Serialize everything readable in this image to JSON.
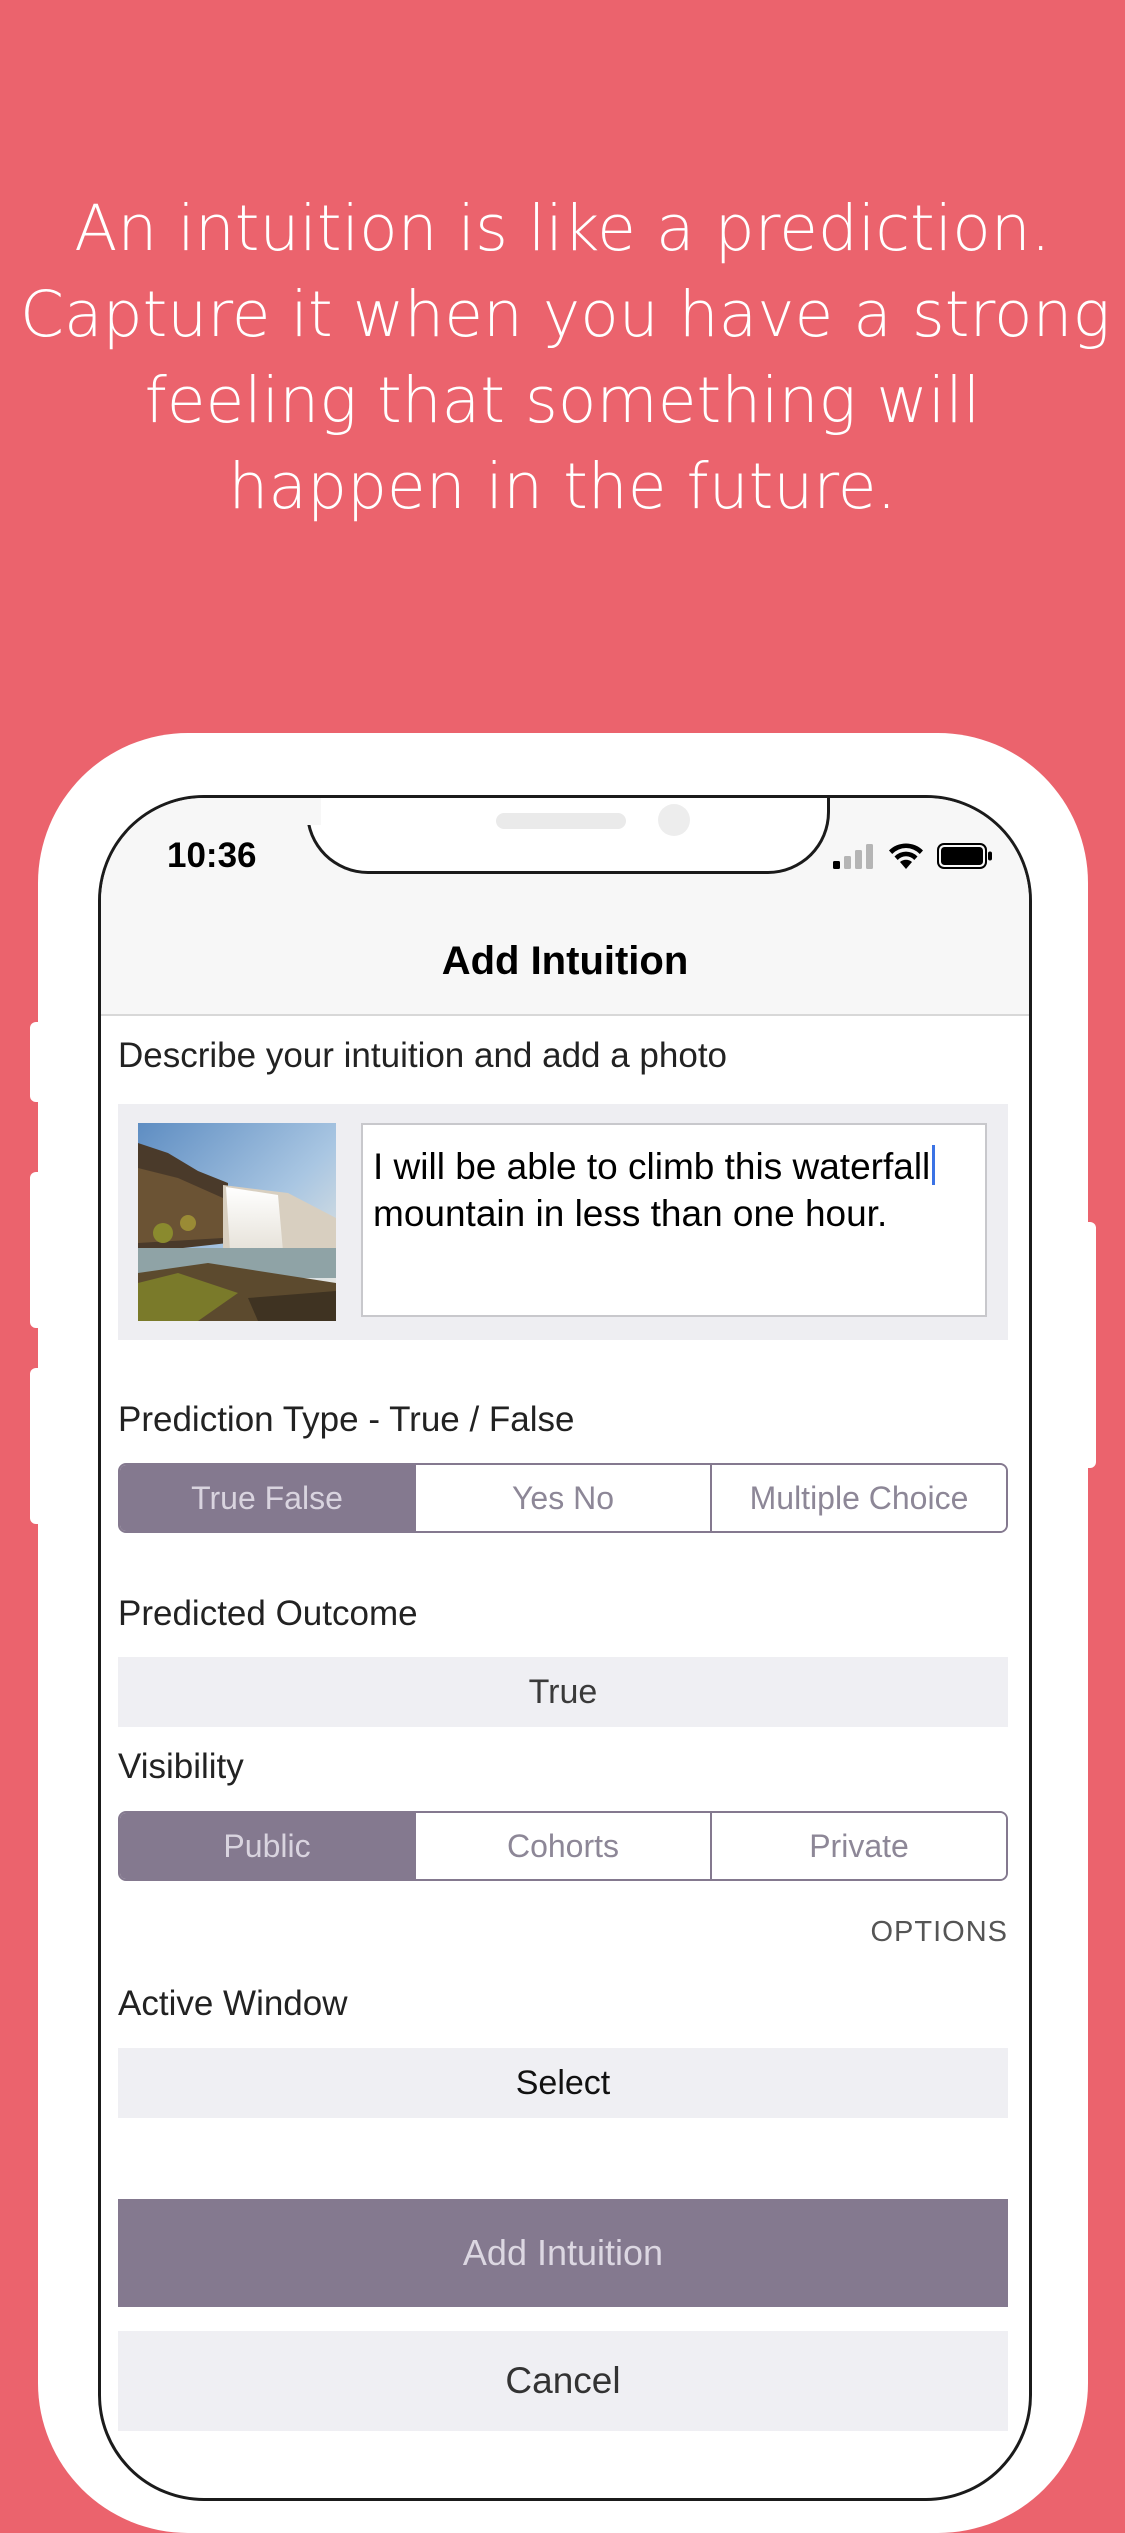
{
  "background_color": "#EB636D",
  "accent_color": "#84798F",
  "headline": {
    "lines": [
      "An intuition is like a prediction.",
      "Capture it when you have a strong",
      "feeling that something will",
      "happen in the future."
    ]
  },
  "status_bar": {
    "time": "10:36",
    "icons": [
      "signal-icon",
      "wifi-icon",
      "battery-icon"
    ]
  },
  "nav": {
    "title": "Add Intuition"
  },
  "form": {
    "describe_label": "Describe your intuition and add a photo",
    "photo_icon": "waterfall-photo",
    "description_text_before_caret": "I will be able to climb this waterfall",
    "description_text_after_caret": " mountain in less than one hour.",
    "prediction_type_label": "Prediction Type - True / False",
    "prediction_types": [
      "True False",
      "Yes No",
      "Multiple Choice"
    ],
    "prediction_type_selected": "True False",
    "predicted_outcome_label": "Predicted Outcome",
    "predicted_outcome_value": "True",
    "visibility_label": "Visibility",
    "visibility_options": [
      "Public",
      "Cohorts",
      "Private"
    ],
    "visibility_selected": "Public",
    "options_label": "OPTIONS",
    "active_window_label": "Active Window",
    "active_window_value": "Select",
    "add_button": "Add Intuition",
    "cancel_button": "Cancel"
  }
}
